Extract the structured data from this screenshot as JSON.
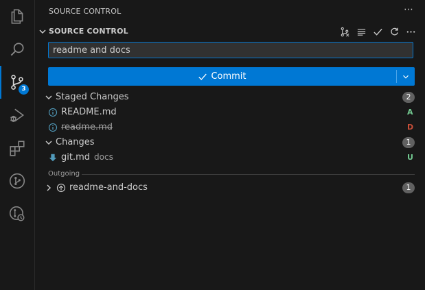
{
  "activity_bar": {
    "items": [
      {
        "name": "explorer",
        "icon": "files-icon"
      },
      {
        "name": "search",
        "icon": "search-icon"
      },
      {
        "name": "source-control",
        "icon": "source-control-icon",
        "badge": "3",
        "active": true
      },
      {
        "name": "run-debug",
        "icon": "run-debug-icon"
      },
      {
        "name": "extensions",
        "icon": "extensions-icon"
      },
      {
        "name": "git-graph",
        "icon": "git-graph-icon"
      },
      {
        "name": "git-history",
        "icon": "git-history-icon"
      }
    ]
  },
  "sidebar": {
    "view_title": "SOURCE CONTROL",
    "more_label": "⋯",
    "section": {
      "title": "SOURCE CONTROL",
      "actions": [
        "view-graph-icon",
        "view-as-list-icon",
        "commit-check-icon",
        "refresh-icon",
        "more-icon"
      ]
    },
    "message_input": {
      "value": "readme and docs",
      "placeholder": ""
    },
    "commit_button": {
      "label": "Commit"
    },
    "staged": {
      "title": "Staged Changes",
      "count": "2",
      "files": [
        {
          "name": "README.md",
          "status": "A",
          "status_color": "#73c991",
          "strike": false
        },
        {
          "name": "readme.md",
          "status": "D",
          "status_color": "#c74e39",
          "strike": true
        }
      ]
    },
    "changes": {
      "title": "Changes",
      "count": "1",
      "files": [
        {
          "name": "git.md",
          "desc": "docs",
          "status": "U",
          "status_color": "#73c991"
        }
      ]
    },
    "outgoing": {
      "title": "Outgoing",
      "item": {
        "label": "readme-and-docs",
        "count": "1"
      }
    }
  },
  "colors": {
    "accent": "#0078d4",
    "background": "#181818",
    "badge": "#616161"
  }
}
